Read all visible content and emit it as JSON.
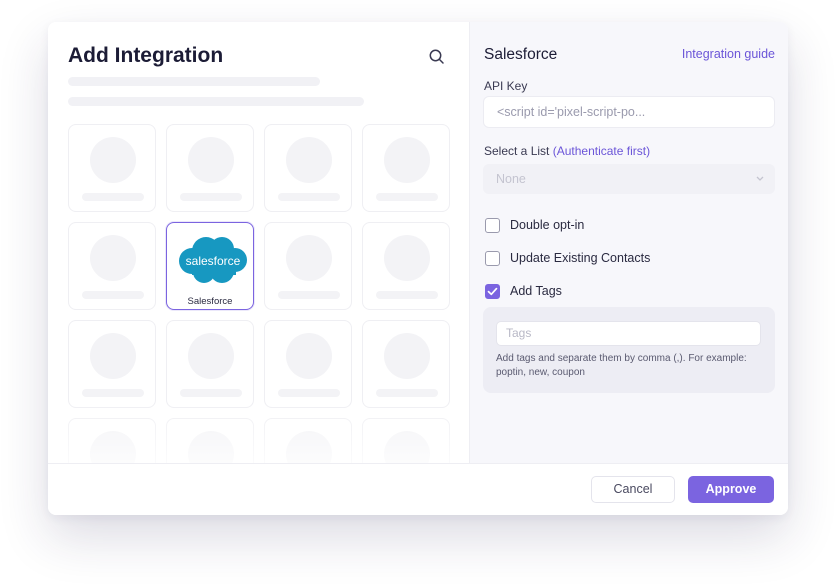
{
  "left": {
    "title": "Add Integration",
    "search_icon": "search-icon",
    "selected_integration": {
      "name": "Salesforce",
      "logo_text": "salesforce",
      "logo_color": "#1798c1"
    }
  },
  "right": {
    "title": "Salesforce",
    "guide_link": "Integration guide",
    "api_key_label": "API Key",
    "api_key_value": "<script id='pixel-script-po...",
    "list_label": "Select a List",
    "list_label_note": "(Authenticate first)",
    "list_selected": "None",
    "options": [
      {
        "label": "Double opt-in",
        "checked": false
      },
      {
        "label": "Update Existing Contacts",
        "checked": false
      },
      {
        "label": "Add Tags",
        "checked": true
      }
    ],
    "tags_placeholder": "Tags",
    "tags_help": "Add tags and separate them by comma (,). For example: poptin, new, coupon"
  },
  "footer": {
    "cancel_label": "Cancel",
    "approve_label": "Approve"
  },
  "colors": {
    "accent": "#7b64e0",
    "link": "#6b55d8",
    "title": "#1c1c36"
  }
}
